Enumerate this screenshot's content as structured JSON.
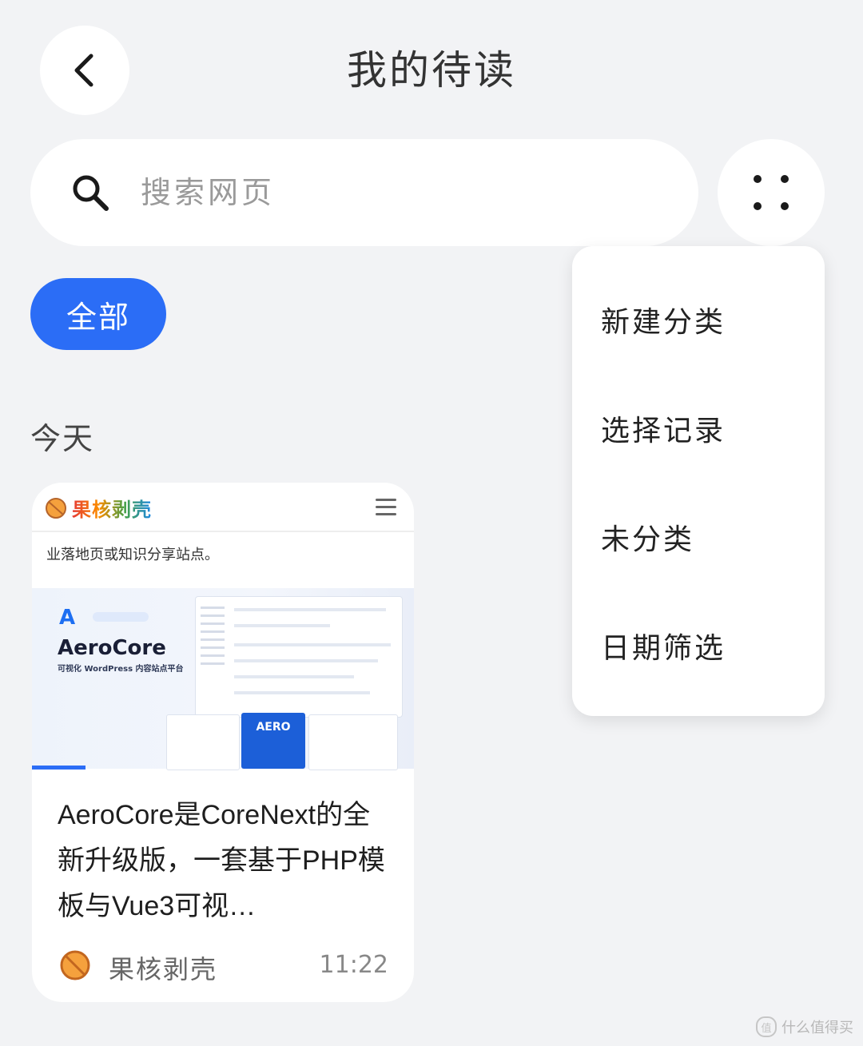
{
  "header": {
    "title": "我的待读"
  },
  "search": {
    "placeholder": "搜索网页"
  },
  "filters": {
    "all_label": "全部"
  },
  "section": {
    "today": "今天"
  },
  "card": {
    "thumb_brand": "果核剥壳",
    "thumb_tagline": "业落地页或知识分享站点。",
    "thumb_product": "AeroCore",
    "thumb_product_sub": "可视化 WordPress 内容站点平台",
    "thumb_aero": "AERO",
    "title": "AeroCore是CoreNext的全新升级版，一套基于PHP模板与Vue3可视…",
    "source": "果核剥壳",
    "time": "11:22",
    "read_progress": 0.14
  },
  "menu": {
    "items": [
      "新建分类",
      "选择记录",
      "未分类",
      "日期筛选"
    ]
  },
  "watermark": {
    "text": "什么值得买"
  },
  "colors": {
    "accent": "#2b6df6",
    "background": "#f2f3f5",
    "brand_orange": "#f5a13d"
  },
  "icons": {
    "back": "chevron-left-icon",
    "search": "search-icon",
    "more": "four-dots-icon"
  }
}
